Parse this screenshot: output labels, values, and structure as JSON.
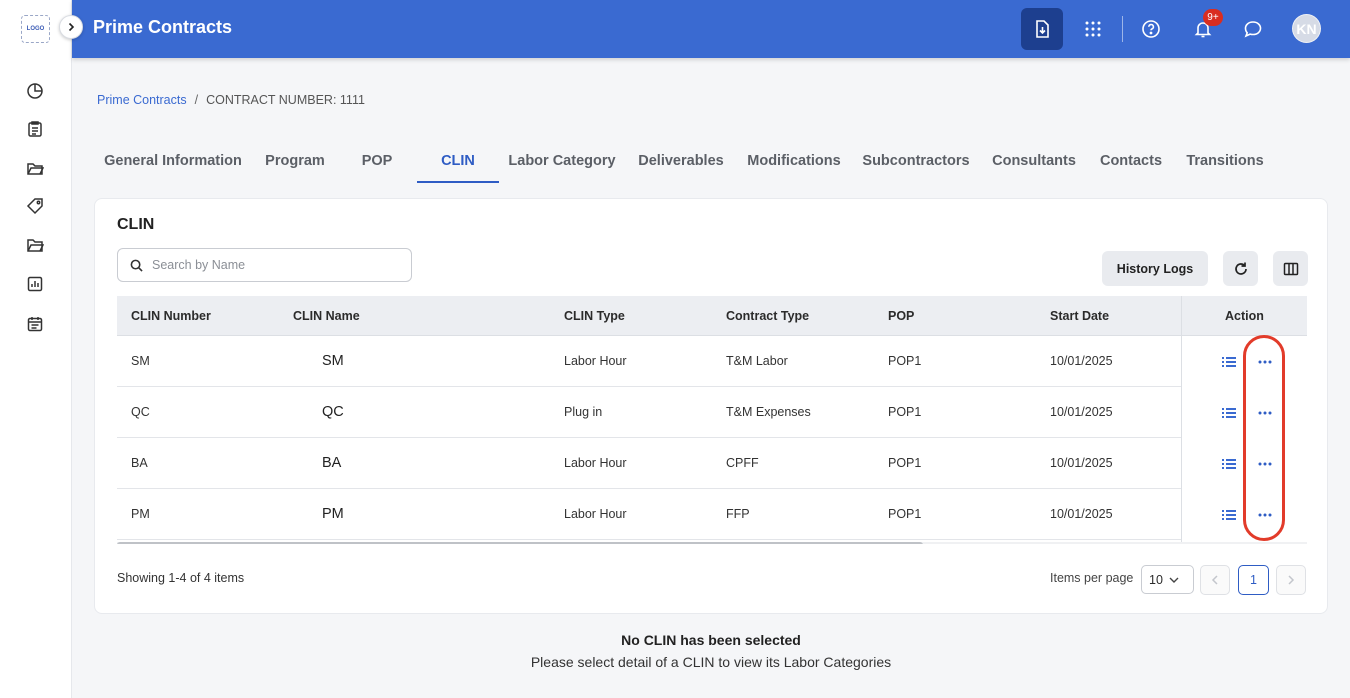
{
  "sidebar": {
    "logo_text": "LOGO",
    "items": [
      {
        "icon": "pie-chart-icon"
      },
      {
        "icon": "clipboard-icon"
      },
      {
        "icon": "folder-open-icon"
      },
      {
        "icon": "tag-icon"
      },
      {
        "icon": "folder-icon"
      },
      {
        "icon": "report-chart-icon"
      },
      {
        "icon": "calendar-icon"
      }
    ]
  },
  "header": {
    "title": "Prime Contracts",
    "notification_badge": "9+",
    "avatar_initials": "KN"
  },
  "breadcrumb": {
    "root": "Prime Contracts",
    "separator": "/",
    "current": "CONTRACT NUMBER: 1111"
  },
  "tabs": [
    {
      "label": "General Information"
    },
    {
      "label": "Program"
    },
    {
      "label": "POP"
    },
    {
      "label": "CLIN",
      "active": true
    },
    {
      "label": "Labor Category"
    },
    {
      "label": "Deliverables"
    },
    {
      "label": "Modifications"
    },
    {
      "label": "Subcontractors"
    },
    {
      "label": "Consultants"
    },
    {
      "label": "Contacts"
    },
    {
      "label": "Transitions"
    }
  ],
  "card": {
    "title": "CLIN",
    "search_placeholder": "Search by Name",
    "history_logs_label": "History Logs"
  },
  "table": {
    "columns": [
      "CLIN Number",
      "CLIN Name",
      "CLIN Type",
      "Contract Type",
      "POP",
      "Start Date",
      "Action"
    ],
    "rows": [
      {
        "number": "SM",
        "name": "SM",
        "type": "Labor Hour",
        "contract_type": "T&M Labor",
        "pop": "POP1",
        "start_date": "10/01/2025"
      },
      {
        "number": "QC",
        "name": "QC",
        "type": "Plug in",
        "contract_type": "T&M Expenses",
        "pop": "POP1",
        "start_date": "10/01/2025"
      },
      {
        "number": "BA",
        "name": "BA",
        "type": "Labor Hour",
        "contract_type": "CPFF",
        "pop": "POP1",
        "start_date": "10/01/2025"
      },
      {
        "number": "PM",
        "name": "PM",
        "type": "Labor Hour",
        "contract_type": "FFP",
        "pop": "POP1",
        "start_date": "10/01/2025"
      }
    ]
  },
  "pagination": {
    "summary": "Showing 1-4 of 4 items",
    "items_per_page_label": "Items per page",
    "items_per_page": "10",
    "current_page": "1"
  },
  "empty_state": {
    "title": "No CLIN has been selected",
    "subtitle": "Please select detail of a CLIN to view its Labor Categories"
  },
  "colors": {
    "header_bg": "#3a6ad1",
    "accent": "#2e5cc4",
    "highlight": "#e23b2a",
    "badge": "#d92d20"
  }
}
